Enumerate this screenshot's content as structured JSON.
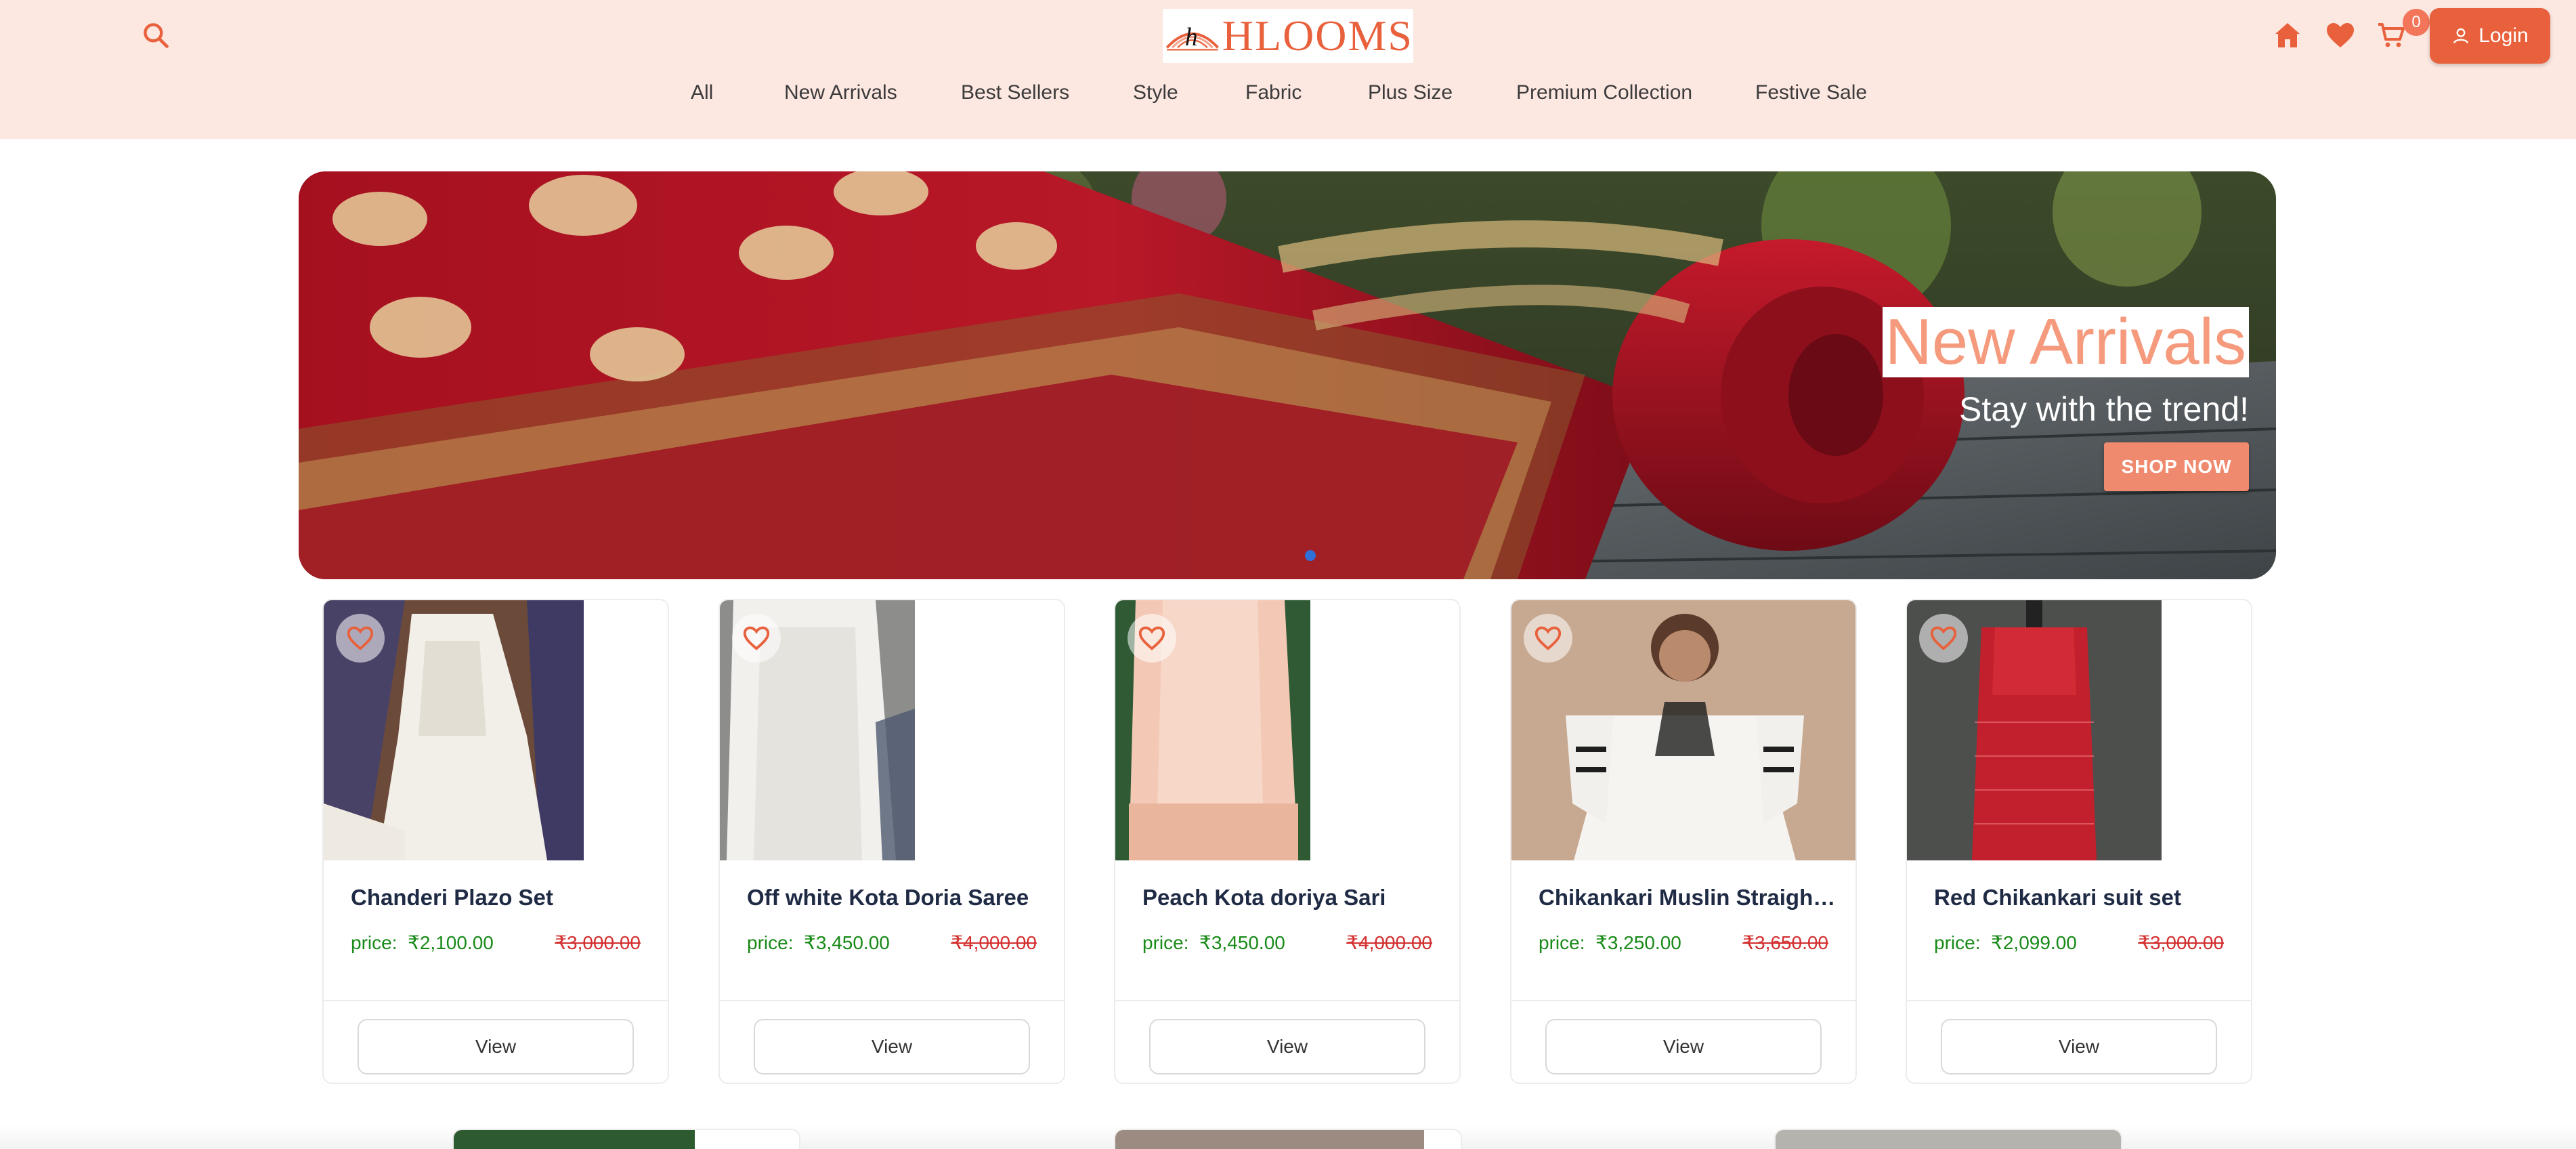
{
  "brand": {
    "name": "HLOOMS",
    "mark": "h"
  },
  "header": {
    "cart_count": "0",
    "login_label": "Login"
  },
  "nav": [
    "All",
    "New Arrivals",
    "Best Sellers",
    "Style",
    "Fabric",
    "Plus Size",
    "Premium Collection",
    "Festive Sale"
  ],
  "banner": {
    "title": "New Arrivals",
    "subtitle": "Stay with the trend!",
    "cta": "SHOP NOW",
    "slide_index": 1
  },
  "price_prefix": "price:",
  "view_label": "View",
  "products": [
    {
      "name": "Chanderi Plazo Set",
      "price": "₹2,100.00",
      "old_price": "₹3,000.00"
    },
    {
      "name": "Off white Kota Doria Saree",
      "price": "₹3,450.00",
      "old_price": "₹4,000.00"
    },
    {
      "name": "Peach Kota doriya Sari",
      "price": "₹3,450.00",
      "old_price": "₹4,000.00"
    },
    {
      "name": "Chikankari Muslin Straight ...",
      "price": "₹3,250.00",
      "old_price": "₹3,650.00"
    },
    {
      "name": "Red Chikankari suit set",
      "price": "₹2,099.00",
      "old_price": "₹3,000.00"
    }
  ],
  "colors": {
    "header_bg": "#fde7e1",
    "accent": "#e8613c",
    "price_green": "#178a17",
    "old_price_red": "#d32f2f",
    "banner_title": "#f59a7c"
  },
  "icons": [
    "search-icon",
    "home-icon",
    "heart-icon",
    "cart-icon",
    "user-icon",
    "heart-outline-icon"
  ]
}
